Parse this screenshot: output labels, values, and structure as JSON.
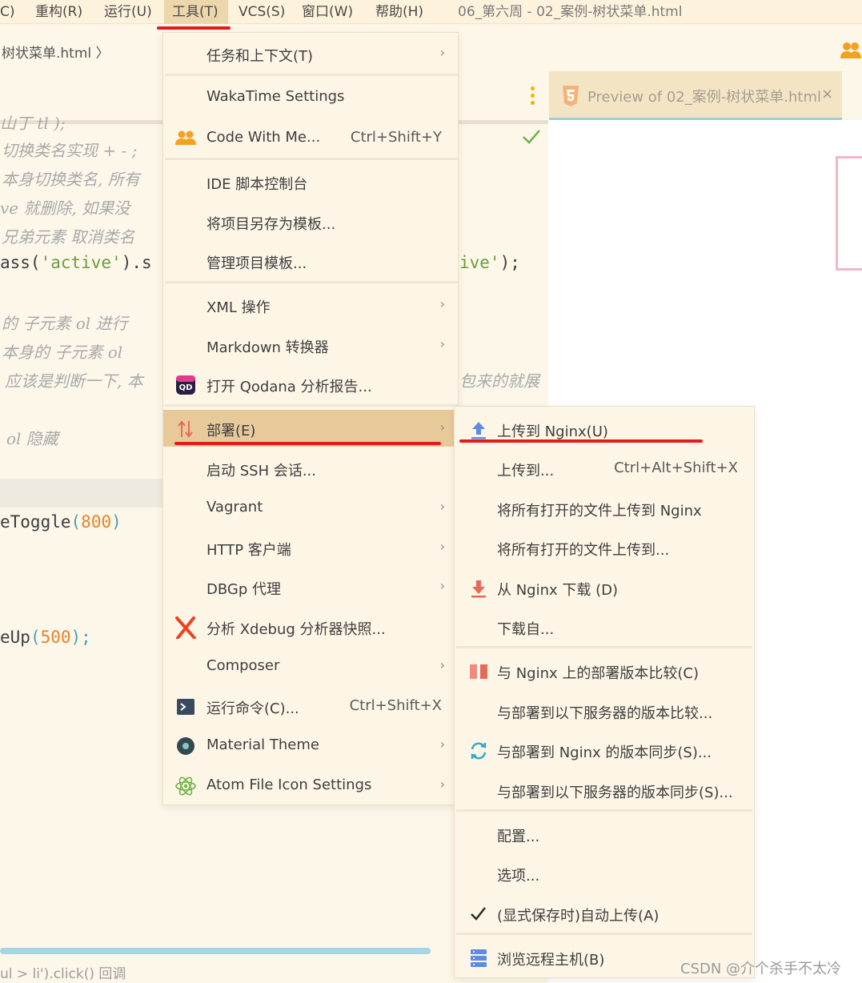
{
  "menubar": {
    "items": [
      "C)",
      "重构(R)",
      "运行(U)",
      "工具(T)",
      "VCS(S)",
      "窗口(W)",
      "帮助(H)"
    ],
    "window_title": "06_第六周 - 02_案例-树状菜单.html"
  },
  "editor": {
    "breadcrumb": "树状菜单.html 〉",
    "code_lines": [
      {
        "kind": "comment",
        "text": "山丁 tl );"
      },
      {
        "kind": "comment",
        "text": "切换类名实现 + - ;"
      },
      {
        "kind": "comment",
        "text": "本身切换类名, 所有"
      },
      {
        "kind": "comment",
        "text": "ve 就删除, 如果没"
      },
      {
        "kind": "comment",
        "text": "兄弟元素 取消类名"
      },
      {
        "kind": "comment",
        "text": "的 子元素 ol 进行"
      },
      {
        "kind": "comment",
        "text": "本身的 子元素 ol"
      },
      {
        "kind": "comment",
        "text": "应该是判断一下, 本"
      },
      {
        "kind": "comment",
        "text": "ol 隐藏"
      },
      {
        "kind": "comment",
        "text": "包来的就展"
      }
    ],
    "code_ass_1": "ass(",
    "code_ass_2": "'active'",
    "code_ass_3": ").s",
    "code_ive_1": "ive'",
    "code_ive_2": ");",
    "toggle_ident": "eToggle",
    "toggle_open": "(",
    "toggle_num": "800",
    "toggle_close": ")",
    "up_ident": "eUp",
    "up_open": "(",
    "up_num": "500",
    "up_close": ");",
    "status_text": "ul > li').click() 回调"
  },
  "preview_tab": {
    "title": "Preview of 02_案例-树状菜单.html",
    "close": "×"
  },
  "tools_menu": {
    "items": [
      {
        "label": "任务和上下文(T)",
        "submenu": true
      },
      {
        "label": "WakaTime Settings"
      },
      {
        "label": "Code With Me...",
        "shortcut": "Ctrl+Shift+Y",
        "icon": "people-icon"
      },
      {
        "label": "IDE 脚本控制台"
      },
      {
        "label": "将项目另存为模板..."
      },
      {
        "label": "管理项目模板..."
      },
      {
        "label": "XML 操作",
        "submenu": true
      },
      {
        "label": "Markdown 转换器",
        "submenu": true
      },
      {
        "label": "打开 Qodana 分析报告...",
        "icon": "qodana-icon"
      },
      {
        "label": "部署(E)",
        "submenu": true,
        "selected": true,
        "icon": "deploy-arrows-icon"
      },
      {
        "label": "启动 SSH 会话..."
      },
      {
        "label": "Vagrant",
        "submenu": true
      },
      {
        "label": "HTTP 客户端",
        "submenu": true
      },
      {
        "label": "DBGp 代理",
        "submenu": true
      },
      {
        "label": "分析 Xdebug 分析器快照...",
        "icon": "xdebug-icon"
      },
      {
        "label": "Composer",
        "submenu": true
      },
      {
        "label": "运行命令(C)...",
        "shortcut": "Ctrl+Shift+X",
        "icon": "terminal-icon"
      },
      {
        "label": "Material Theme",
        "submenu": true,
        "icon": "material-theme-icon"
      },
      {
        "label": "Atom File Icon Settings",
        "submenu": true,
        "icon": "atom-icon"
      }
    ]
  },
  "deploy_menu": {
    "items": [
      {
        "label": "上传到 Nginx(U)",
        "icon": "upload-icon"
      },
      {
        "label": "上传到...",
        "shortcut": "Ctrl+Alt+Shift+X"
      },
      {
        "label": "将所有打开的文件上传到 Nginx"
      },
      {
        "label": "将所有打开的文件上传到..."
      },
      {
        "label": "从 Nginx 下载 (D)",
        "icon": "download-icon"
      },
      {
        "label": "下载自..."
      },
      {
        "label": "与 Nginx 上的部署版本比较(C)",
        "icon": "compare-icon"
      },
      {
        "label": "与部署到以下服务器的版本比较..."
      },
      {
        "label": "与部署到 Nginx 的版本同步(S)...",
        "icon": "sync-icon"
      },
      {
        "label": "与部署到以下服务器的版本同步(S)..."
      },
      {
        "label": "配置..."
      },
      {
        "label": "选项..."
      },
      {
        "label": "(显式保存时)自动上传(A)",
        "icon": "checkmark-icon"
      },
      {
        "label": "浏览远程主机(B)",
        "icon": "server-icon"
      }
    ]
  },
  "watermark": "CSDN @介个杀手不太冷",
  "colors": {
    "background": "#fdf7ea",
    "menu_bg": "#fdf6e7",
    "selected_item": "#e8c99a",
    "annotation_red": "#e21b1b",
    "preview_bg": "#ffffff"
  }
}
